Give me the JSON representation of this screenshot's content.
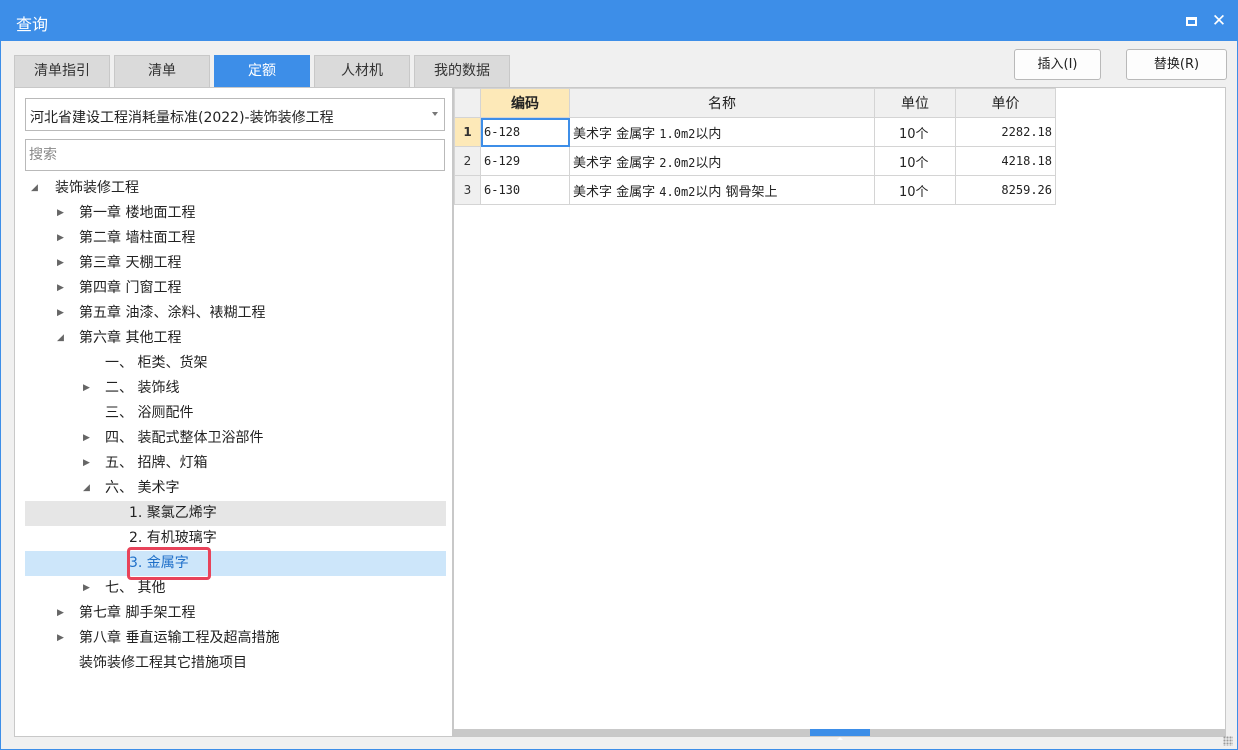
{
  "window": {
    "title": "查询",
    "accent": "#3d8ee8"
  },
  "tabs": [
    {
      "label": "清单指引",
      "active": false
    },
    {
      "label": "清单",
      "active": false
    },
    {
      "label": "定额",
      "active": true
    },
    {
      "label": "人材机",
      "active": false
    },
    {
      "label": "我的数据",
      "active": false
    }
  ],
  "actions": {
    "insert": "插入(I)",
    "replace": "替换(R)"
  },
  "library_select": {
    "value": "河北省建设工程消耗量标准(2022)-装饰装修工程"
  },
  "search": {
    "placeholder": "搜索"
  },
  "tree": [
    {
      "label": "装饰装修工程",
      "twisty": "◢"
    },
    {
      "label": "第一章 楼地面工程",
      "twisty": "▶"
    },
    {
      "label": "第二章 墙柱面工程",
      "twisty": "▶"
    },
    {
      "label": "第三章 天棚工程",
      "twisty": "▶"
    },
    {
      "label": "第四章 门窗工程",
      "twisty": "▶"
    },
    {
      "label": "第五章 油漆、涂料、裱糊工程",
      "twisty": "▶"
    },
    {
      "label": "第六章 其他工程",
      "twisty": "◢"
    },
    {
      "label": "一、 柜类、货架",
      "twisty": ""
    },
    {
      "label": "二、 装饰线",
      "twisty": "▶"
    },
    {
      "label": "三、 浴厕配件",
      "twisty": ""
    },
    {
      "label": "四、 装配式整体卫浴部件",
      "twisty": "▶"
    },
    {
      "label": "五、 招牌、灯箱",
      "twisty": "▶"
    },
    {
      "label": "六、 美术字",
      "twisty": "◢"
    },
    {
      "label": "1. 聚氯乙烯字",
      "twisty": ""
    },
    {
      "label": "2. 有机玻璃字",
      "twisty": ""
    },
    {
      "label": "3. 金属字",
      "twisty": ""
    },
    {
      "label": "七、 其他",
      "twisty": "▶"
    },
    {
      "label": "第七章 脚手架工程",
      "twisty": "▶"
    },
    {
      "label": "第八章 垂直运输工程及超高措施",
      "twisty": "▶"
    },
    {
      "label": "装饰装修工程其它措施项目",
      "twisty": ""
    }
  ],
  "grid": {
    "columns": [
      "编码",
      "名称",
      "单位",
      "单价"
    ],
    "rows": [
      {
        "num": "1",
        "code": "6-128",
        "name_cn": "美术字 金属字 ",
        "name_spec": "1.0m2",
        "name_tail": "以内",
        "unit": "10个",
        "price": "2282.18"
      },
      {
        "num": "2",
        "code": "6-129",
        "name_cn": "美术字 金属字 ",
        "name_spec": "2.0m2",
        "name_tail": "以内",
        "unit": "10个",
        "price": "4218.18"
      },
      {
        "num": "3",
        "code": "6-130",
        "name_cn": "美术字 金属字 ",
        "name_spec": "4.0m2",
        "name_tail": "以内 钢骨架上",
        "unit": "10个",
        "price": "8259.26"
      }
    ]
  },
  "icons": {
    "maximize": "maximize-icon",
    "close": "close-icon",
    "dropdown": "chevron-down-icon",
    "scroll": "scroll-up-icon",
    "grip": "resize-grip-icon"
  }
}
